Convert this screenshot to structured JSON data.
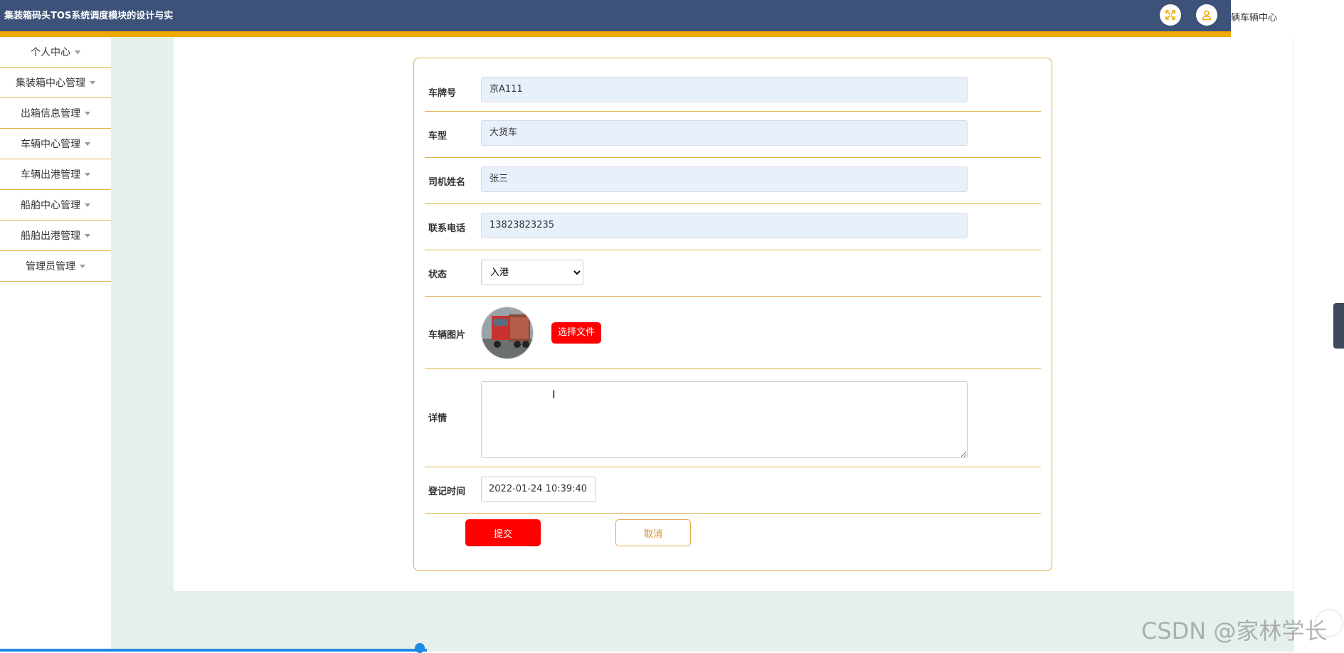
{
  "header": {
    "title": "集装箱码头TOS系统调度模块的设计与实",
    "right_text": "辆车辆中心"
  },
  "sidebar": {
    "items": [
      {
        "label": "个人中心"
      },
      {
        "label": "集装箱中心管理"
      },
      {
        "label": "出箱信息管理"
      },
      {
        "label": "车辆中心管理"
      },
      {
        "label": "车辆出港管理"
      },
      {
        "label": "船舶中心管理"
      },
      {
        "label": "船舶出港管理"
      },
      {
        "label": "管理员管理"
      }
    ]
  },
  "form": {
    "plate": {
      "label": "车牌号",
      "value": "京A111"
    },
    "vehicle_type": {
      "label": "车型",
      "value": "大货车"
    },
    "driver_name": {
      "label": "司机姓名",
      "value": "张三"
    },
    "phone": {
      "label": "联系电话",
      "value": "13823823235"
    },
    "status": {
      "label": "状态",
      "value": "入港"
    },
    "photo": {
      "label": "车辆图片",
      "button": "选择文件"
    },
    "details": {
      "label": "详情",
      "value": ""
    },
    "register_time": {
      "label": "登记时间",
      "value": "2022-01-24 10:39:40"
    },
    "submit_label": "提交",
    "cancel_label": "取消"
  },
  "watermark": "CSDN @家林学长",
  "colors": {
    "header_bg": "#3d5278",
    "header_accent": "#f0a800",
    "primary_red": "#ff0000",
    "border_gold": "#e0a84a",
    "input_bg": "#e8f0fb",
    "page_bg": "#e6f0ea"
  }
}
